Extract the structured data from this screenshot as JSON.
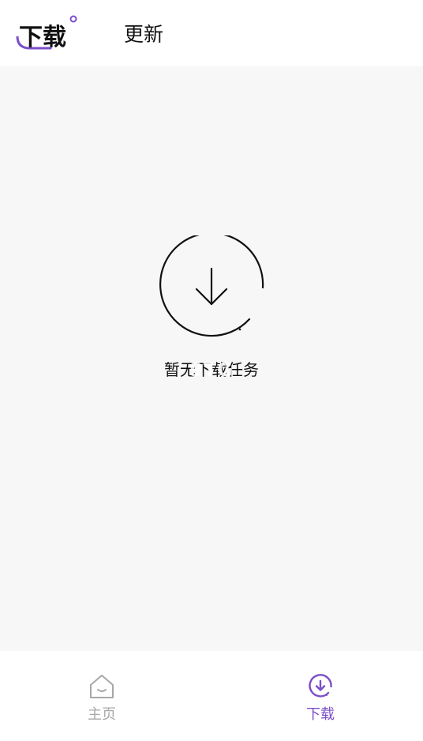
{
  "header": {
    "tabs": [
      {
        "label": "下载",
        "active": true
      },
      {
        "label": "更新",
        "active": false
      }
    ]
  },
  "main": {
    "empty_message": "暂无下载任务",
    "icon": "download-circle-icon",
    "watermark": "9TG"
  },
  "bottom_nav": {
    "items": [
      {
        "label": "主页",
        "icon": "home-icon",
        "active": false
      },
      {
        "label": "下载",
        "icon": "download-icon",
        "active": true
      }
    ]
  },
  "colors": {
    "accent": "#7b4fc9",
    "inactive": "#a8a8a8",
    "background": "#f7f7f7",
    "text": "#111111"
  }
}
